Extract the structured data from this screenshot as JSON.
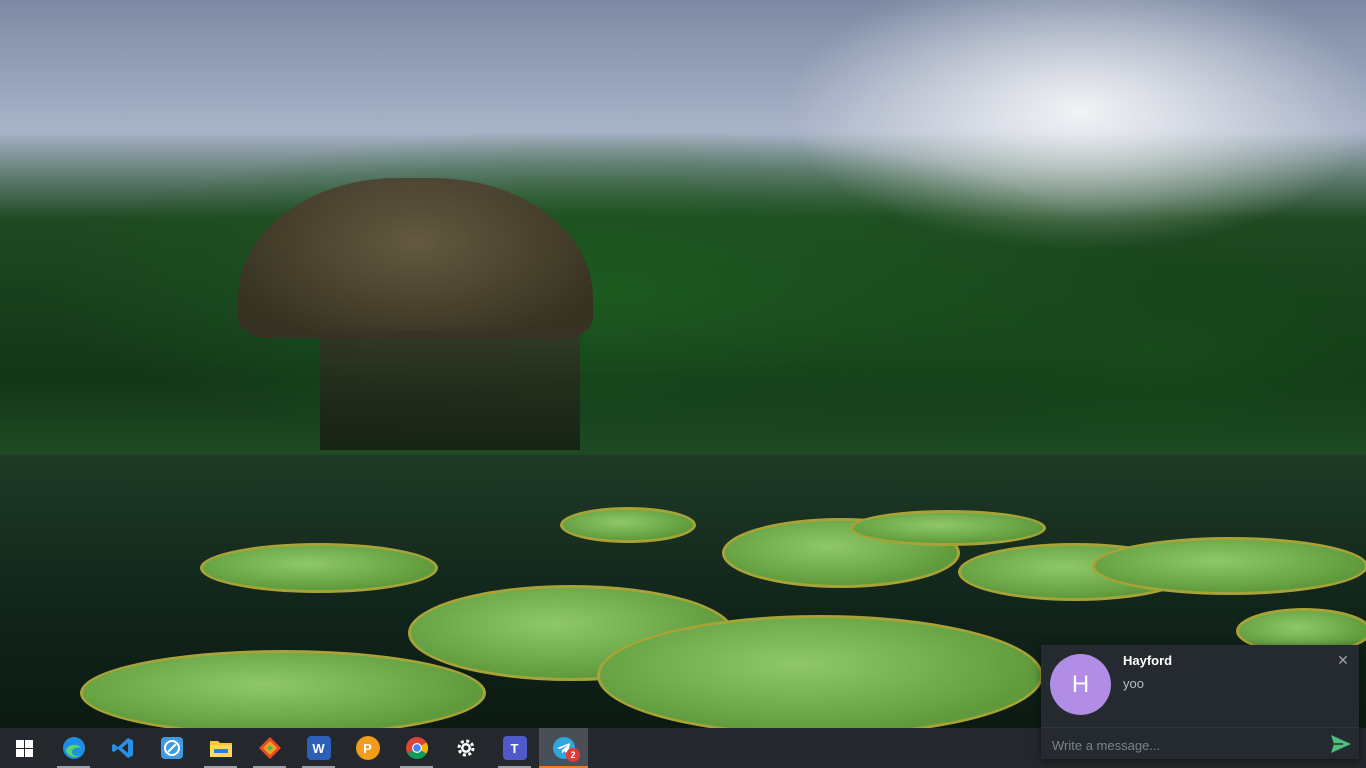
{
  "desktop": {
    "wallpaper": "jungle-hut-lily-pads"
  },
  "taskbar": {
    "background": "#24282d",
    "items": [
      {
        "name": "windows-start",
        "icon": "windows-logo-icon",
        "running": false,
        "active": false
      },
      {
        "name": "edge",
        "icon": "edge-icon",
        "running": true,
        "active": false
      },
      {
        "name": "vscode",
        "icon": "vscode-icon",
        "running": false,
        "active": false
      },
      {
        "name": "snipping",
        "icon": "pen-tool-icon",
        "running": false,
        "active": false
      },
      {
        "name": "file-explorer",
        "icon": "folder-icon",
        "running": true,
        "active": false
      },
      {
        "name": "git",
        "icon": "git-icon",
        "running": true,
        "active": false
      },
      {
        "name": "word",
        "icon": "word-icon",
        "glyph": "W",
        "running": true,
        "active": false
      },
      {
        "name": "pomodoro",
        "icon": "orange-circle-icon",
        "glyph": "P",
        "running": false,
        "active": false
      },
      {
        "name": "chrome",
        "icon": "chrome-icon",
        "running": true,
        "active": false
      },
      {
        "name": "settings",
        "icon": "gear-icon",
        "running": false,
        "active": false
      },
      {
        "name": "teams",
        "icon": "teams-icon",
        "glyph": "T",
        "running": true,
        "active": false
      },
      {
        "name": "telegram",
        "icon": "telegram-icon",
        "badge": "2",
        "running": true,
        "active": true
      }
    ]
  },
  "notification": {
    "avatar_letter": "H",
    "avatar_color": "#b18de6",
    "sender": "Hayford",
    "message": "yoo",
    "reply_placeholder": "Write a message...",
    "close_glyph": "✕",
    "send_color": "#4fbf7a"
  }
}
